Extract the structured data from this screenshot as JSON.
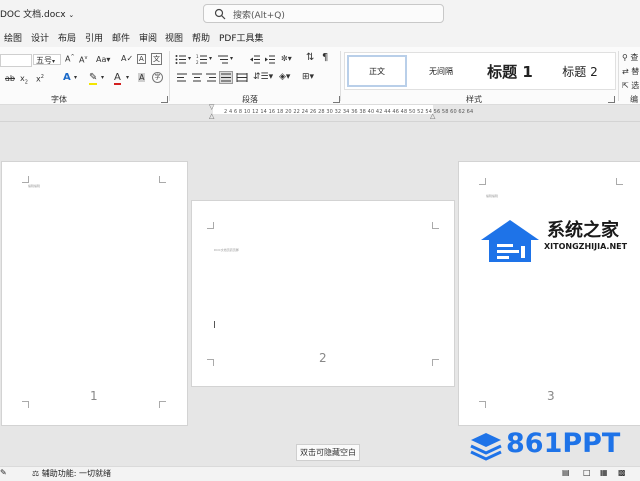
{
  "titlebar": {
    "doc_title": "DOC 文档.docx",
    "search_placeholder": "搜索(Alt+Q)"
  },
  "menu": [
    "绘图",
    "设计",
    "布局",
    "引用",
    "邮件",
    "审阅",
    "视图",
    "帮助",
    "PDF工具集"
  ],
  "ribbon": {
    "font_size": "五号",
    "font_group_label": "字体",
    "paragraph_group_label": "段落",
    "styles_group_label": "样式",
    "styles": [
      "正文",
      "无间隔",
      "标题 1",
      "标题 2"
    ],
    "right_partial": [
      "查",
      "替",
      "选",
      "编"
    ]
  },
  "ruler": {
    "numbers": "2 4 6 8 10 12 14 16 18 20 22 24 26 28 30 32 34 36 38 40 42 44 46 48 50 52 54 56 58 60 62 64"
  },
  "pages": [
    {
      "number": "1",
      "text": "编辑编辑"
    },
    {
      "number": "2",
      "text": "DOC文档页眉页脚"
    },
    {
      "number": "3",
      "text": "编辑编辑"
    }
  ],
  "tooltip": "双击可隐藏空白",
  "statusbar": {
    "accessibility": "辅助功能: 一切就绪"
  },
  "watermarks": {
    "xitong_cn": "系统之家",
    "xitong_url": "XITONGZHIJIA.NET",
    "brand_861": "861PPT"
  },
  "colors": {
    "accent": "#185abd",
    "watermark_blue": "#1e73e8"
  }
}
